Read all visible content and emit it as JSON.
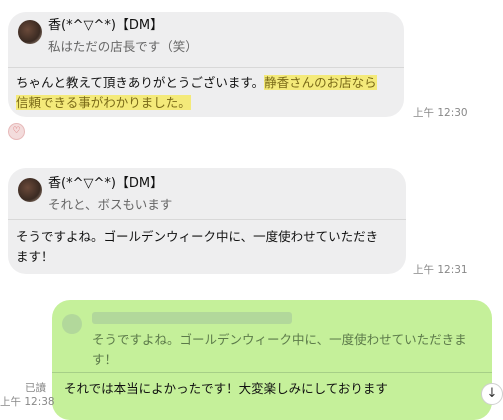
{
  "messages": [
    {
      "sender": "香(*^▽^*)【DM】",
      "quoted": "私はただの店長です（笑）",
      "text_plain": "ちゃんと教えて頂きありがとうございます。",
      "text_highlight_line1": "静香さんのお店なら",
      "text_highlight_line2": "信頼できる事がわかりました。",
      "time": "上午 12:30"
    },
    {
      "sender": "香(*^▽^*)【DM】",
      "quoted": "それと、ボスもいます",
      "text_line1": "そうですよね。ゴールデンウィーク中に、一度使わせていただき",
      "text_line2": "ます！",
      "time": "上午 12:31"
    },
    {
      "quoted_line1": "そうですよね。ゴールデンウィーク中に、一度使わせていただきま",
      "quoted_line2": "す！",
      "text": "それでは本当によかったです！大変楽しみにしております",
      "read": "已讀",
      "time": "上午 12:38"
    }
  ],
  "reaction_icon": "heart-reaction-icon",
  "scroll_button_icon": "arrow-down-icon",
  "scroll_button_glyph": "↓"
}
